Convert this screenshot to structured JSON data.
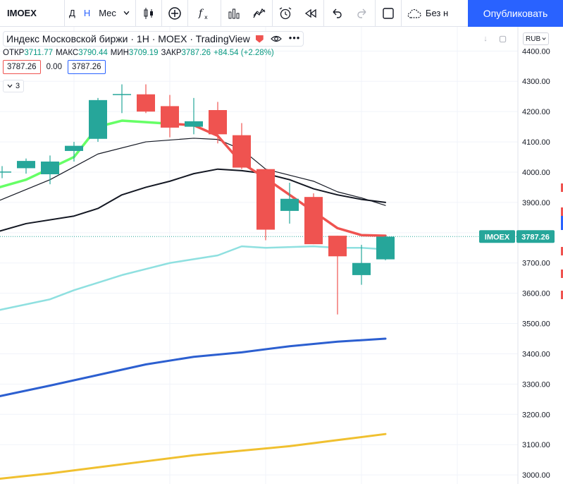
{
  "toolbar": {
    "symbol": "IMOEX",
    "intervals": [
      "Д",
      "Н",
      "Мес"
    ],
    "active_interval": "Н",
    "save_label": "Без н",
    "publish_label": "Опубликовать"
  },
  "legend": {
    "title": "Индекс Московской биржи · 1H · MOEX · TradingView",
    "ohlc": [
      {
        "k": "ОТКР",
        "v": "3711.77"
      },
      {
        "k": "МАКС",
        "v": "3790.44"
      },
      {
        "k": "МИН",
        "v": "3709.19"
      },
      {
        "k": "ЗАКР",
        "v": "3787.26"
      }
    ],
    "change": "+84.54 (+2.28%)",
    "value_red": "3787.26",
    "value_mid": "0.00",
    "value_blue": "3787.26",
    "collapsed_count": "3"
  },
  "currency": "RUB",
  "colors": {
    "up": "#26a69a",
    "down": "#ef5350",
    "ma_green": "#66ff66",
    "ma_red": "#ef5350",
    "ma_black": "#131722",
    "ma_cyan": "#8fe0e0",
    "ma_blue": "#2c5fd0",
    "ma_gold": "#f0c030"
  },
  "chart_data": {
    "type": "candlestick",
    "ylim": [
      2970,
      4480
    ],
    "yticks": [
      "3000.00",
      "3100.00",
      "3200.00",
      "3300.00",
      "3400.00",
      "3500.00",
      "3600.00",
      "3700.00",
      "3800.00",
      "3900.00",
      "4000.00",
      "4100.00",
      "4200.00",
      "4300.00",
      "4400.00"
    ],
    "last_price": {
      "symbol": "IMOEX",
      "value": "3787.26"
    },
    "candles": [
      {
        "o": 4002,
        "h": 4020,
        "l": 3980,
        "c": 4002
      },
      {
        "o": 4013,
        "h": 4045,
        "l": 3995,
        "c": 4037
      },
      {
        "o": 3993,
        "h": 4055,
        "l": 3960,
        "c": 4035
      },
      {
        "o": 4070,
        "h": 4100,
        "l": 4035,
        "c": 4087
      },
      {
        "o": 4110,
        "h": 4245,
        "l": 4100,
        "c": 4238
      },
      {
        "o": 4258,
        "h": 4290,
        "l": 4195,
        "c": 4258
      },
      {
        "o": 4257,
        "h": 4290,
        "l": 4195,
        "c": 4200
      },
      {
        "o": 4218,
        "h": 4255,
        "l": 4115,
        "c": 4147
      },
      {
        "o": 4150,
        "h": 4245,
        "l": 4125,
        "c": 4168
      },
      {
        "o": 4205,
        "h": 4232,
        "l": 4095,
        "c": 4125
      },
      {
        "o": 4122,
        "h": 4162,
        "l": 4010,
        "c": 4015
      },
      {
        "o": 4010,
        "h": 4010,
        "l": 3775,
        "c": 3810
      },
      {
        "o": 3872,
        "h": 3965,
        "l": 3830,
        "c": 3912
      },
      {
        "o": 3918,
        "h": 3930,
        "l": 3762,
        "c": 3762
      },
      {
        "o": 3790,
        "h": 3790,
        "l": 3530,
        "c": 3722
      },
      {
        "o": 3660,
        "h": 3760,
        "l": 3628,
        "c": 3700
      },
      {
        "o": 3712,
        "h": 3790,
        "l": 3709,
        "c": 3787
      }
    ],
    "series": [
      {
        "color_key": "ma_green",
        "width": 3.5,
        "points": [
          [
            -1,
            3930
          ],
          [
            1,
            3975
          ],
          [
            3,
            4050
          ],
          [
            4,
            4150
          ],
          [
            5,
            4170
          ],
          [
            6,
            4165
          ],
          [
            7,
            4160
          ]
        ]
      },
      {
        "color_key": "ma_red",
        "width": 3.5,
        "points": [
          [
            7,
            4160
          ],
          [
            8,
            4155
          ],
          [
            9,
            4120
          ],
          [
            10,
            4030
          ],
          [
            11,
            3980
          ],
          [
            12,
            3925
          ],
          [
            13,
            3870
          ],
          [
            14,
            3815
          ],
          [
            15,
            3792
          ],
          [
            16,
            3790
          ]
        ]
      },
      {
        "color_key": "ma_black",
        "width": 1.2,
        "points": [
          [
            -1,
            3880
          ],
          [
            0,
            3910
          ],
          [
            2,
            3975
          ],
          [
            4,
            4060
          ],
          [
            6,
            4100
          ],
          [
            8,
            4112
          ],
          [
            9,
            4108
          ],
          [
            10,
            4075
          ],
          [
            11,
            4010
          ],
          [
            12,
            3990
          ],
          [
            13,
            3970
          ],
          [
            14,
            3935
          ],
          [
            15,
            3915
          ],
          [
            16,
            3890
          ]
        ]
      },
      {
        "color_key": "ma_black",
        "width": 2.0,
        "points": [
          [
            -1,
            3785
          ],
          [
            1,
            3830
          ],
          [
            3,
            3855
          ],
          [
            4,
            3880
          ],
          [
            5,
            3925
          ],
          [
            6,
            3950
          ],
          [
            7,
            3970
          ],
          [
            8,
            3995
          ],
          [
            9,
            4010
          ],
          [
            10,
            4005
          ],
          [
            11,
            3995
          ],
          [
            12,
            3975
          ],
          [
            13,
            3945
          ],
          [
            14,
            3925
          ],
          [
            15,
            3910
          ],
          [
            16,
            3900
          ]
        ]
      },
      {
        "color_key": "ma_cyan",
        "width": 2.5,
        "points": [
          [
            -1,
            3530
          ],
          [
            2,
            3580
          ],
          [
            3,
            3610
          ],
          [
            5,
            3660
          ],
          [
            7,
            3700
          ],
          [
            9,
            3725
          ],
          [
            10,
            3755
          ],
          [
            11,
            3750
          ],
          [
            13,
            3755
          ],
          [
            14,
            3750
          ],
          [
            15,
            3750
          ],
          [
            16,
            3745
          ]
        ]
      },
      {
        "color_key": "ma_blue",
        "width": 3.0,
        "points": [
          [
            -1,
            3245
          ],
          [
            2,
            3295
          ],
          [
            4,
            3330
          ],
          [
            6,
            3365
          ],
          [
            8,
            3390
          ],
          [
            10,
            3405
          ],
          [
            12,
            3425
          ],
          [
            14,
            3440
          ],
          [
            16,
            3450
          ]
        ]
      },
      {
        "color_key": "ma_gold",
        "width": 3.0,
        "points": [
          [
            -1,
            2980
          ],
          [
            2,
            3005
          ],
          [
            4,
            3025
          ],
          [
            6,
            3045
          ],
          [
            8,
            3065
          ],
          [
            10,
            3080
          ],
          [
            12,
            3095
          ],
          [
            14,
            3115
          ],
          [
            16,
            3135
          ]
        ]
      }
    ]
  }
}
